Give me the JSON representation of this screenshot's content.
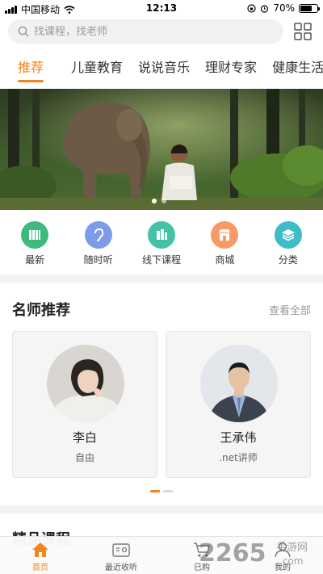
{
  "status_bar": {
    "carrier": "中国移动",
    "time": "12:13",
    "battery": "70%",
    "battery_level": 0.7
  },
  "search": {
    "placeholder": "找课程，找老师"
  },
  "tabs": [
    {
      "label": "推荐",
      "active": true
    },
    {
      "label": "儿童教育"
    },
    {
      "label": "说说音乐"
    },
    {
      "label": "理财专家"
    },
    {
      "label": "健康生活"
    }
  ],
  "quick_entries": [
    {
      "label": "最新",
      "color": "#3dbb7d",
      "icon": "book-icon"
    },
    {
      "label": "随时听",
      "color": "#7d9be8",
      "icon": "ear-icon"
    },
    {
      "label": "线下课程",
      "color": "#45c1a6",
      "icon": "books-icon"
    },
    {
      "label": "商城",
      "color": "#f89a65",
      "icon": "shop-icon"
    },
    {
      "label": "分类",
      "color": "#3fbcc8",
      "icon": "layers-icon"
    }
  ],
  "teachers_section": {
    "title": "名师推荐",
    "see_all": "查看全部",
    "teachers": [
      {
        "name": "李白",
        "title": "自由"
      },
      {
        "name": "王承伟",
        "title": ".net讲师"
      }
    ]
  },
  "courses_section": {
    "title": "精品课程"
  },
  "bottom_nav": [
    {
      "label": "首页",
      "active": true,
      "icon": "home-icon"
    },
    {
      "label": "最近收听",
      "icon": "radio-icon"
    },
    {
      "label": "已购",
      "icon": "cart-icon"
    },
    {
      "label": "我的",
      "icon": "user-icon"
    }
  ],
  "watermark": {
    "text": "2265",
    "subtext": "手游网",
    "domain": ".com"
  },
  "colors": {
    "accent": "#f0861c"
  }
}
